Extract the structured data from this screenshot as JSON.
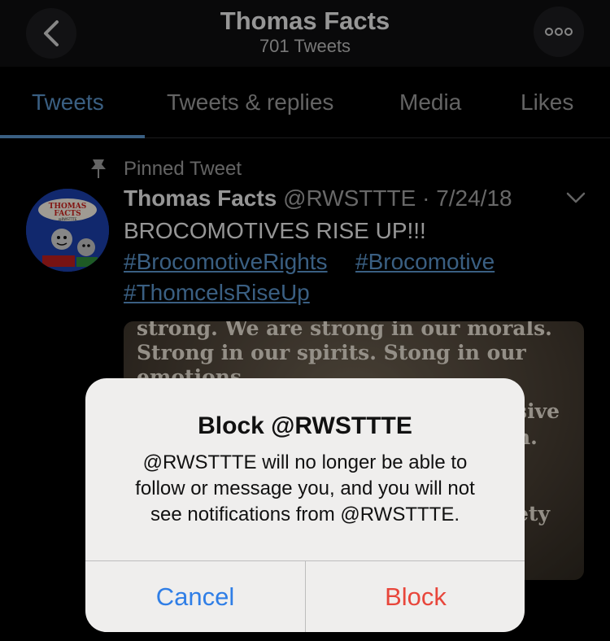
{
  "header": {
    "title": "Thomas Facts",
    "tweet_count": "701 Tweets"
  },
  "tabs": [
    {
      "label": "Tweets",
      "active": true
    },
    {
      "label": "Tweets & replies",
      "active": false
    },
    {
      "label": "Media",
      "active": false
    },
    {
      "label": "Likes",
      "active": false
    }
  ],
  "tweet": {
    "pinned_label": "Pinned Tweet",
    "name": "Thomas Facts",
    "handle": "@RWSTTTE",
    "date": "7/24/18",
    "text": "BROCOMOTIVES RISE UP!!!",
    "hashtags": [
      "#BrocomotiveRights",
      "#Brocomotive",
      "#ThomcelsRiseUp"
    ],
    "avatar_text": [
      "THOMAS",
      "FACTS",
      "@RWSTTTE"
    ],
    "media_lines": [
      "strong. We are strong in our morals.",
      "Strong in our spirits. Stong in our",
      "emotions"
    ],
    "media_fragments": [
      "sive",
      "n.",
      "ety"
    ]
  },
  "alert": {
    "title": "Block @RWSTTTE",
    "message_lines": [
      "@RWSTTTE will no longer be able to",
      "follow or message you, and you will not",
      "see notifications from @RWSTTTE."
    ],
    "cancel_label": "Cancel",
    "block_label": "Block"
  },
  "colors": {
    "accent": "#5a93c8",
    "cancel": "#2f7ee6",
    "destructive": "#e8463b"
  }
}
